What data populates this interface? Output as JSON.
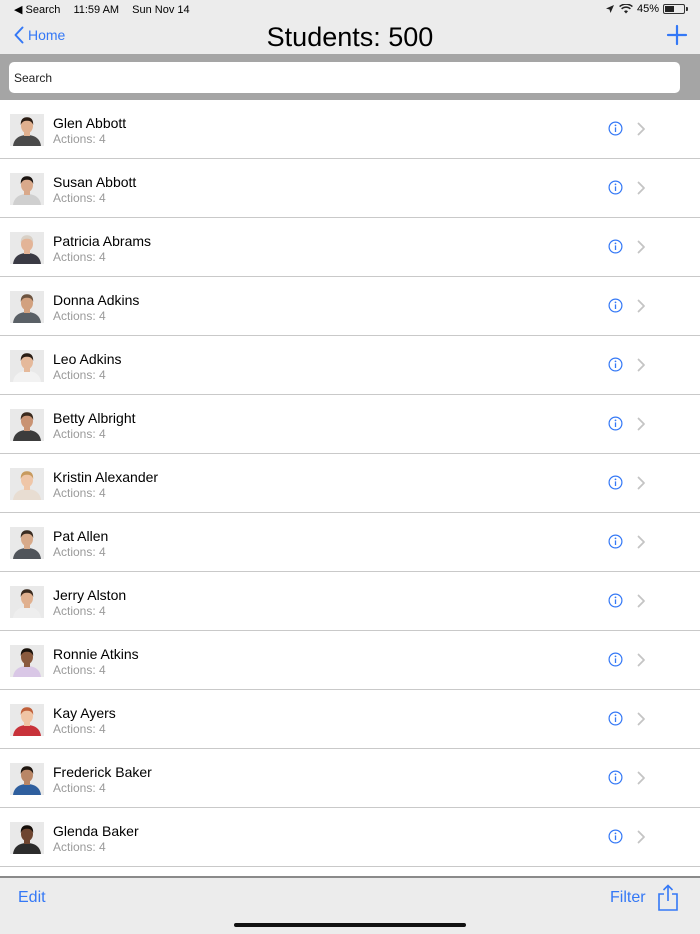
{
  "status_bar": {
    "back_app": "◀ Search",
    "time": "11:59 AM",
    "date": "Sun Nov 14",
    "battery": "45%",
    "battery_level": 0.45
  },
  "nav": {
    "back_label": "Home",
    "title": "Students: 500"
  },
  "search": {
    "placeholder": "Search",
    "value": ""
  },
  "students": [
    {
      "name": "Glen Abbott",
      "sub": "Actions: 4",
      "skin": "#e0b08f",
      "hair": "#2b1d14",
      "shirt": "#4a4a4a"
    },
    {
      "name": "Susan Abbott",
      "sub": "Actions: 4",
      "skin": "#d9a98b",
      "hair": "#1a1410",
      "shirt": "#cfcfcf"
    },
    {
      "name": "Patricia Abrams",
      "sub": "Actions: 4",
      "skin": "#e3b497",
      "hair": "#d8d0c6",
      "shirt": "#3a3a44"
    },
    {
      "name": "Donna Adkins",
      "sub": "Actions: 4",
      "skin": "#d2a17f",
      "hair": "#6d5440",
      "shirt": "#5a6066"
    },
    {
      "name": "Leo Adkins",
      "sub": "Actions: 4",
      "skin": "#e5b99b",
      "hair": "#2a1e16",
      "shirt": "#f2f2f2"
    },
    {
      "name": "Betty Albright",
      "sub": "Actions: 4",
      "skin": "#c99373",
      "hair": "#3a2a1e",
      "shirt": "#3c3c3c"
    },
    {
      "name": "Kristin Alexander",
      "sub": "Actions: 4",
      "skin": "#efc6a8",
      "hair": "#c79a5e",
      "shirt": "#e8ddd2"
    },
    {
      "name": "Pat Allen",
      "sub": "Actions: 4",
      "skin": "#d8aa8a",
      "hair": "#3a2c22",
      "shirt": "#50545a"
    },
    {
      "name": "Jerry Alston",
      "sub": "Actions: 4",
      "skin": "#e0b08f",
      "hair": "#3a2a1e",
      "shirt": "#eeeeee"
    },
    {
      "name": "Ronnie Atkins",
      "sub": "Actions: 4",
      "skin": "#8a5a3e",
      "hair": "#1a120c",
      "shirt": "#d9c7e6"
    },
    {
      "name": "Kay Ayers",
      "sub": "Actions: 4",
      "skin": "#f0c4a4",
      "hair": "#c0603a",
      "shirt": "#c8323a"
    },
    {
      "name": "Frederick Baker",
      "sub": "Actions: 4",
      "skin": "#b98666",
      "hair": "#1e1610",
      "shirt": "#2f5f9e"
    },
    {
      "name": "Glenda Baker",
      "sub": "Actions: 4",
      "skin": "#6e4530",
      "hair": "#150f0a",
      "shirt": "#2c2c2c"
    }
  ],
  "toolbar": {
    "edit_label": "Edit",
    "filter_label": "Filter"
  },
  "colors": {
    "accent": "#3478f6",
    "search_bar_bg": "#a5a5a5",
    "chrome_bg": "#ececec"
  },
  "icons": {
    "status_back": "triangle-left-icon",
    "location": "location-arrow-icon",
    "wifi": "wifi-icon",
    "battery": "battery-icon",
    "nav_back": "chevron-left-icon",
    "add": "plus-icon",
    "info": "info-circle-icon",
    "disclosure": "chevron-right-icon",
    "share": "share-icon"
  }
}
